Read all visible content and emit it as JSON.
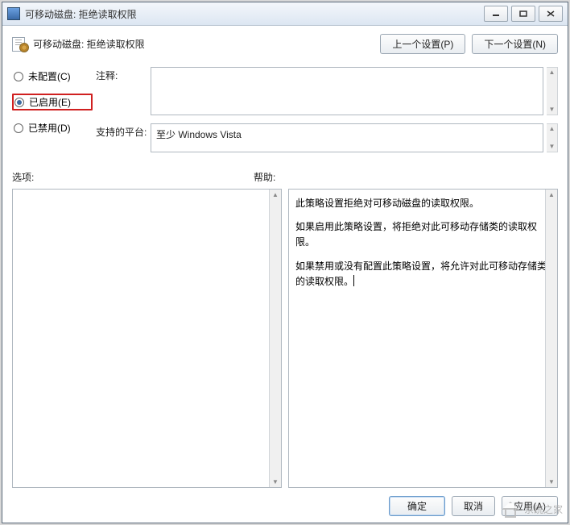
{
  "titlebar": {
    "title": "可移动磁盘: 拒绝读取权限"
  },
  "header": {
    "label": "可移动磁盘: 拒绝读取权限",
    "prev_button": "上一个设置(P)",
    "next_button": "下一个设置(N)"
  },
  "radios": {
    "not_configured": "未配置(C)",
    "enabled": "已启用(E)",
    "disabled": "已禁用(D)",
    "selected": "enabled"
  },
  "labels": {
    "comment": "注释:",
    "supported_platform": "支持的平台:",
    "options": "选项:",
    "help": "帮助:"
  },
  "comment_value": "",
  "platform_value": "至少 Windows Vista",
  "help_text": {
    "p1": "此策略设置拒绝对可移动磁盘的读取权限。",
    "p2": "如果启用此策略设置，将拒绝对此可移动存储类的读取权限。",
    "p3": "如果禁用或没有配置此策略设置，将允许对此可移动存储类的读取权限。"
  },
  "footer": {
    "ok": "确定",
    "cancel": "取消",
    "apply": "应用(A)"
  },
  "watermark": "系统之家"
}
